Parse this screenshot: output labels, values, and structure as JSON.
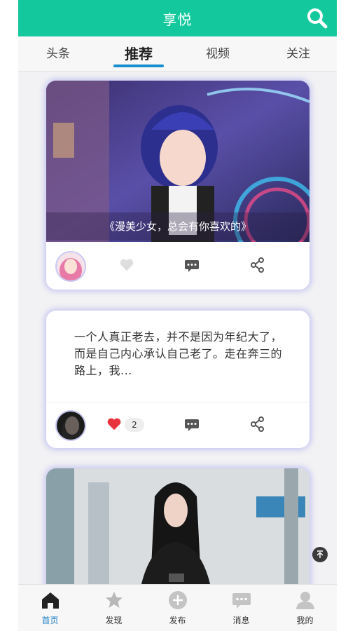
{
  "header": {
    "title": "享悦"
  },
  "tabs": [
    {
      "label": "头条"
    },
    {
      "label": "推荐"
    },
    {
      "label": "视频"
    },
    {
      "label": "关注"
    }
  ],
  "feed": {
    "card1": {
      "caption": "《漫美少女，总会有你喜欢的》"
    },
    "card2": {
      "text": "一个人真正老去，并不是因为年纪大了，而是自己内心承认自己老了。走在奔三的路上，我...",
      "likes": "2"
    }
  },
  "tabbar": [
    {
      "label": "首页"
    },
    {
      "label": "发现"
    },
    {
      "label": "发布"
    },
    {
      "label": "消息"
    },
    {
      "label": "我的"
    }
  ],
  "colors": {
    "accent": "#14c89d",
    "active_blue": "#1b7fc6",
    "like_red": "#e8323c"
  }
}
